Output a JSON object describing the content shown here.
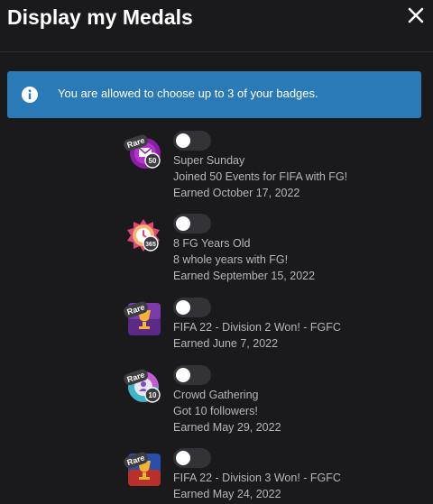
{
  "dialog": {
    "title": "Display my Medals"
  },
  "alert": {
    "message": "You are allowed to choose up to 3 of your badges."
  },
  "medals": [
    {
      "rare_label": "Rare",
      "count": "50",
      "name": "Super Sunday",
      "description": "Joined 50 Events for FIFA with FG!",
      "earned": "Earned October 17, 2022",
      "icon": "envelope-badge-icon",
      "displayed": false
    },
    {
      "count": "365",
      "name": "8 FG Years Old",
      "description": "8 whole years with FG!",
      "earned": "Earned September 15, 2022",
      "icon": "clock-badge-icon",
      "displayed": false
    },
    {
      "rare_label": "Rare",
      "name": "FIFA 22 - Division 2 Won! - FGFC",
      "earned": "Earned June 7, 2022",
      "icon": "trophy-badge-icon",
      "displayed": false
    },
    {
      "rare_label": "Rare",
      "count": "10",
      "name": "Crowd Gathering",
      "description": "Got 10 followers!",
      "earned": "Earned May 29, 2022",
      "icon": "followers-badge-icon",
      "displayed": false
    },
    {
      "rare_label": "Rare",
      "name": "FIFA 22 - Division 3 Won! - FGFC",
      "earned": "Earned May 24, 2022",
      "icon": "trophy-badge-icon",
      "displayed": false
    }
  ]
}
